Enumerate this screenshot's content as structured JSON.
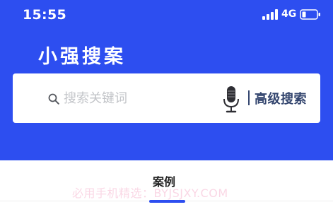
{
  "status_bar": {
    "time": "15:55",
    "network": "4G",
    "icons": [
      "signal-icon",
      "battery-icon"
    ]
  },
  "header": {
    "title": "小强搜案"
  },
  "search": {
    "placeholder": "搜索关键词",
    "value": "",
    "icon": "search-icon",
    "voice_icon": "microphone-icon",
    "advanced_label": "高级搜索"
  },
  "tabs": [
    {
      "label": "案例",
      "active": true
    }
  ],
  "watermark": "必用手机精选：BYJSJXY.COM",
  "colors": {
    "brand_blue": "#2d4ef0",
    "advanced_text": "#34466f",
    "placeholder": "#c2c4c8"
  }
}
